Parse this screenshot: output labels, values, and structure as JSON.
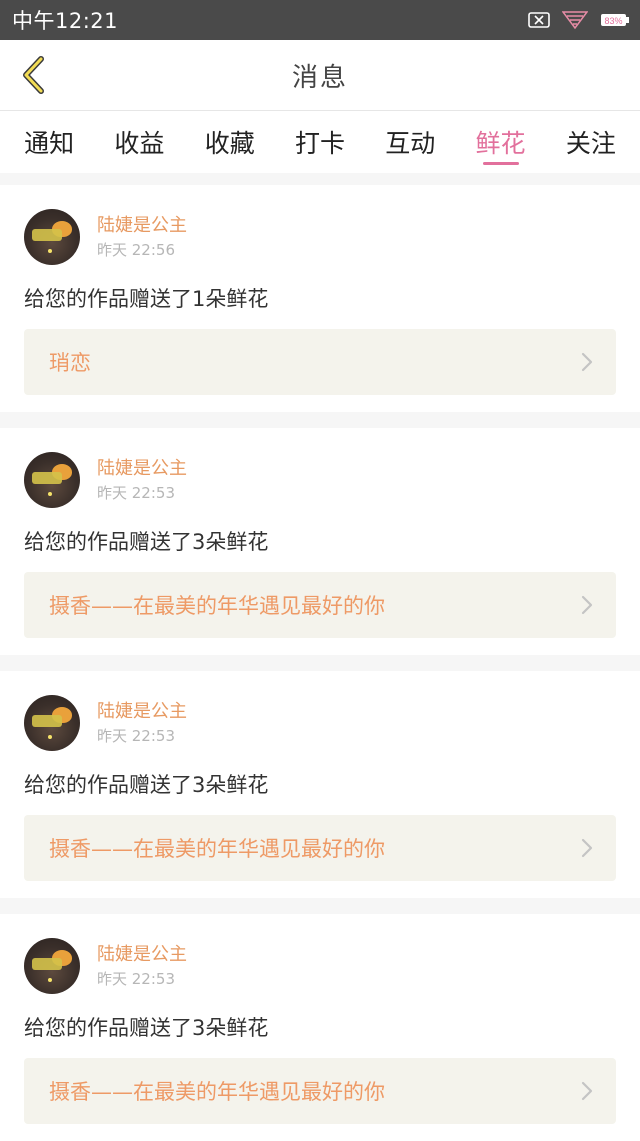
{
  "status_bar": {
    "time": "中午12:21",
    "battery_text": "83%",
    "icons": [
      "close-box-icon",
      "signal-heart-icon",
      "battery-icon"
    ]
  },
  "header": {
    "title": "消息",
    "back_icon": "chevron-left-icon"
  },
  "tabs": [
    {
      "label": "通知",
      "active": false
    },
    {
      "label": "收益",
      "active": false
    },
    {
      "label": "收藏",
      "active": false
    },
    {
      "label": "打卡",
      "active": false
    },
    {
      "label": "互动",
      "active": false
    },
    {
      "label": "鲜花",
      "active": true
    },
    {
      "label": "关注",
      "active": false
    }
  ],
  "colors": {
    "accent": "#e2709c",
    "username": "#e79a62",
    "work_title": "#ee9a66",
    "link_bg": "#f4f3ec"
  },
  "messages": [
    {
      "user": "陆婕是公主",
      "time": "昨天 22:56",
      "text": "给您的作品赠送了1朵鲜花",
      "work": "琑恋"
    },
    {
      "user": "陆婕是公主",
      "time": "昨天 22:53",
      "text": "给您的作品赠送了3朵鲜花",
      "work": "摄香——在最美的年华遇见最好的你"
    },
    {
      "user": "陆婕是公主",
      "time": "昨天 22:53",
      "text": "给您的作品赠送了3朵鲜花",
      "work": "摄香——在最美的年华遇见最好的你"
    },
    {
      "user": "陆婕是公主",
      "time": "昨天 22:53",
      "text": "给您的作品赠送了3朵鲜花",
      "work": "摄香——在最美的年华遇见最好的你"
    }
  ]
}
